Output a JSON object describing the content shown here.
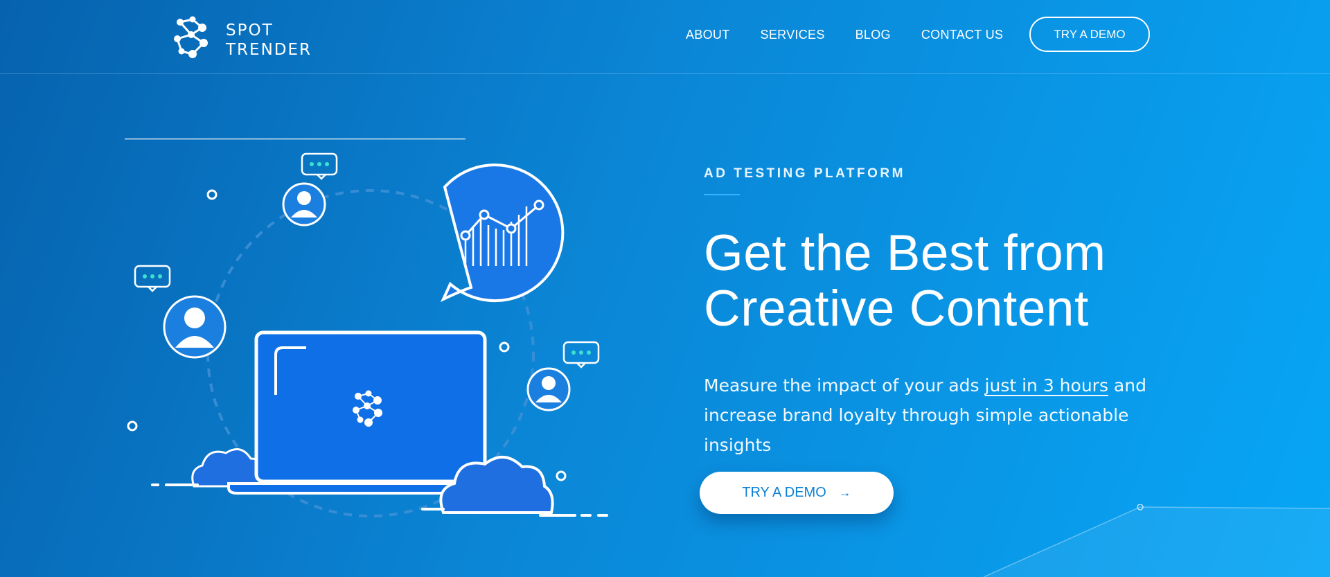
{
  "brand": {
    "line1": "SPOT",
    "line2": "TRENDER"
  },
  "nav": {
    "items": [
      {
        "label": "ABOUT"
      },
      {
        "label": "SERVICES"
      },
      {
        "label": "BLOG"
      },
      {
        "label": "CONTACT US"
      }
    ],
    "demo_button": "TRY A DEMO"
  },
  "hero": {
    "kicker": "AD TESTING PLATFORM",
    "headline_line1": "Get the Best from",
    "headline_line2": "Creative Content",
    "sub_prefix": "Measure the impact of your ads ",
    "sub_highlight": "just in 3 hours",
    "sub_suffix": " and increase brand loyalty through simple actionable insights",
    "cta_label": "TRY A DEMO",
    "cta_icon": "arrow-right-icon"
  },
  "colors": {
    "background_start": "#0662ae",
    "background_end": "#08a6f6",
    "cta_text": "#0a7fd4",
    "accent_line": "#35b4ff"
  }
}
